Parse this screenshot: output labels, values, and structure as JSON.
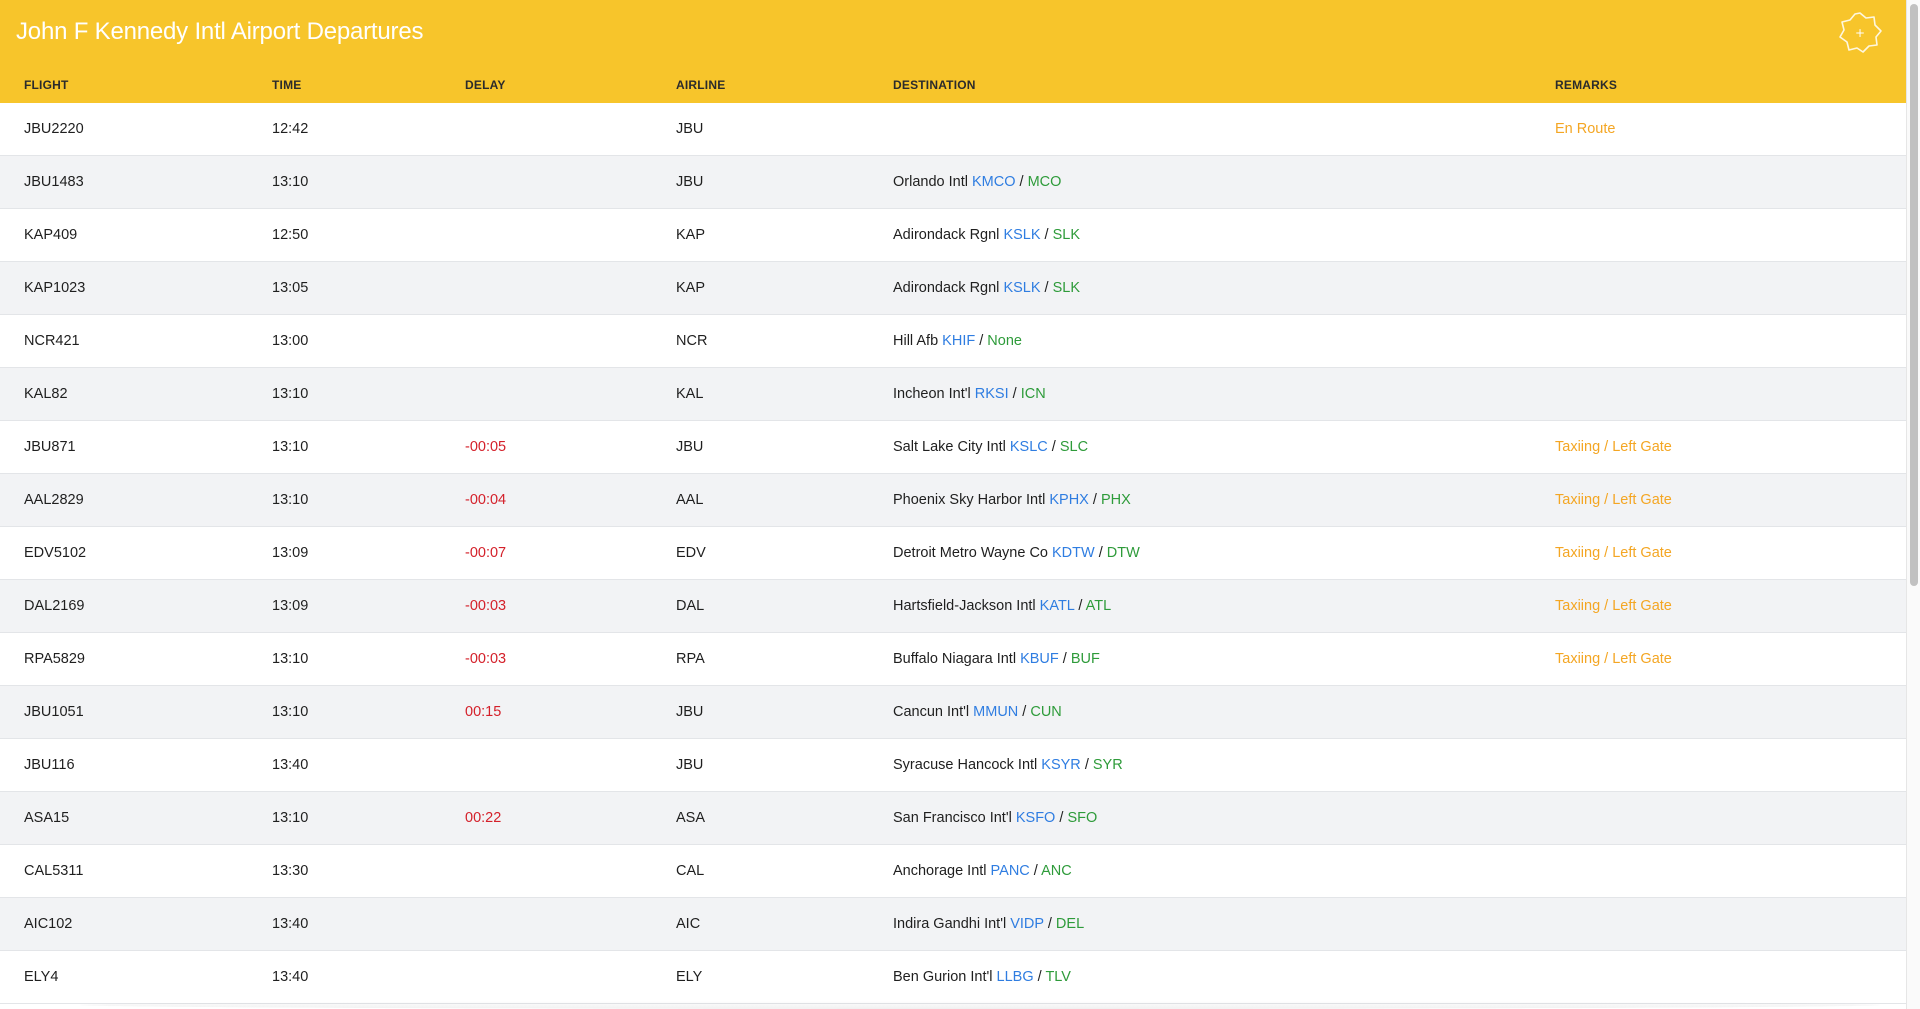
{
  "page": {
    "title": "John F Kennedy Intl Airport Departures"
  },
  "colors": {
    "header_bg": "#f7c52b",
    "delay": "#d4202a",
    "remarks": "#f4a623",
    "icao": "#2f7de1",
    "iata": "#2e9b3a"
  },
  "icons": {
    "settings": "gear-icon"
  },
  "columns": {
    "flight": "FLIGHT",
    "time": "TIME",
    "delay": "DELAY",
    "airline": "AIRLINE",
    "destination": "DESTINATION",
    "remarks": "REMARKS"
  },
  "flights": [
    {
      "flight": "JBU2220",
      "time": "12:42",
      "delay": "",
      "airline": "JBU",
      "dest_name": "",
      "icao": "",
      "iata": "",
      "remarks": "En Route"
    },
    {
      "flight": "JBU1483",
      "time": "13:10",
      "delay": "",
      "airline": "JBU",
      "dest_name": "Orlando Intl",
      "icao": "KMCO",
      "iata": "MCO",
      "remarks": ""
    },
    {
      "flight": "KAP409",
      "time": "12:50",
      "delay": "",
      "airline": "KAP",
      "dest_name": "Adirondack Rgnl",
      "icao": "KSLK",
      "iata": "SLK",
      "remarks": ""
    },
    {
      "flight": "KAP1023",
      "time": "13:05",
      "delay": "",
      "airline": "KAP",
      "dest_name": "Adirondack Rgnl",
      "icao": "KSLK",
      "iata": "SLK",
      "remarks": ""
    },
    {
      "flight": "NCR421",
      "time": "13:00",
      "delay": "",
      "airline": "NCR",
      "dest_name": "Hill Afb",
      "icao": "KHIF",
      "iata": "None",
      "remarks": ""
    },
    {
      "flight": "KAL82",
      "time": "13:10",
      "delay": "",
      "airline": "KAL",
      "dest_name": "Incheon Int'l",
      "icao": "RKSI",
      "iata": "ICN",
      "remarks": ""
    },
    {
      "flight": "JBU871",
      "time": "13:10",
      "delay": "-00:05",
      "airline": "JBU",
      "dest_name": "Salt Lake City Intl",
      "icao": "KSLC",
      "iata": "SLC",
      "remarks": "Taxiing / Left Gate"
    },
    {
      "flight": "AAL2829",
      "time": "13:10",
      "delay": "-00:04",
      "airline": "AAL",
      "dest_name": "Phoenix Sky Harbor Intl",
      "icao": "KPHX",
      "iata": "PHX",
      "remarks": "Taxiing / Left Gate"
    },
    {
      "flight": "EDV5102",
      "time": "13:09",
      "delay": "-00:07",
      "airline": "EDV",
      "dest_name": "Detroit Metro Wayne Co",
      "icao": "KDTW",
      "iata": "DTW",
      "remarks": "Taxiing / Left Gate"
    },
    {
      "flight": "DAL2169",
      "time": "13:09",
      "delay": "-00:03",
      "airline": "DAL",
      "dest_name": "Hartsfield-Jackson Intl",
      "icao": "KATL",
      "iata": "ATL",
      "remarks": "Taxiing / Left Gate"
    },
    {
      "flight": "RPA5829",
      "time": "13:10",
      "delay": "-00:03",
      "airline": "RPA",
      "dest_name": "Buffalo Niagara Intl",
      "icao": "KBUF",
      "iata": "BUF",
      "remarks": "Taxiing / Left Gate"
    },
    {
      "flight": "JBU1051",
      "time": "13:10",
      "delay": "00:15",
      "airline": "JBU",
      "dest_name": "Cancun Int'l",
      "icao": "MMUN",
      "iata": "CUN",
      "remarks": ""
    },
    {
      "flight": "JBU116",
      "time": "13:40",
      "delay": "",
      "airline": "JBU",
      "dest_name": "Syracuse Hancock Intl",
      "icao": "KSYR",
      "iata": "SYR",
      "remarks": ""
    },
    {
      "flight": "ASA15",
      "time": "13:10",
      "delay": "00:22",
      "airline": "ASA",
      "dest_name": "San Francisco Int'l",
      "icao": "KSFO",
      "iata": "SFO",
      "remarks": ""
    },
    {
      "flight": "CAL5311",
      "time": "13:30",
      "delay": "",
      "airline": "CAL",
      "dest_name": "Anchorage Intl",
      "icao": "PANC",
      "iata": "ANC",
      "remarks": ""
    },
    {
      "flight": "AIC102",
      "time": "13:40",
      "delay": "",
      "airline": "AIC",
      "dest_name": "Indira Gandhi Int'l",
      "icao": "VIDP",
      "iata": "DEL",
      "remarks": ""
    },
    {
      "flight": "ELY4",
      "time": "13:40",
      "delay": "",
      "airline": "ELY",
      "dest_name": "Ben Gurion Int'l",
      "icao": "LLBG",
      "iata": "TLV",
      "remarks": ""
    }
  ]
}
